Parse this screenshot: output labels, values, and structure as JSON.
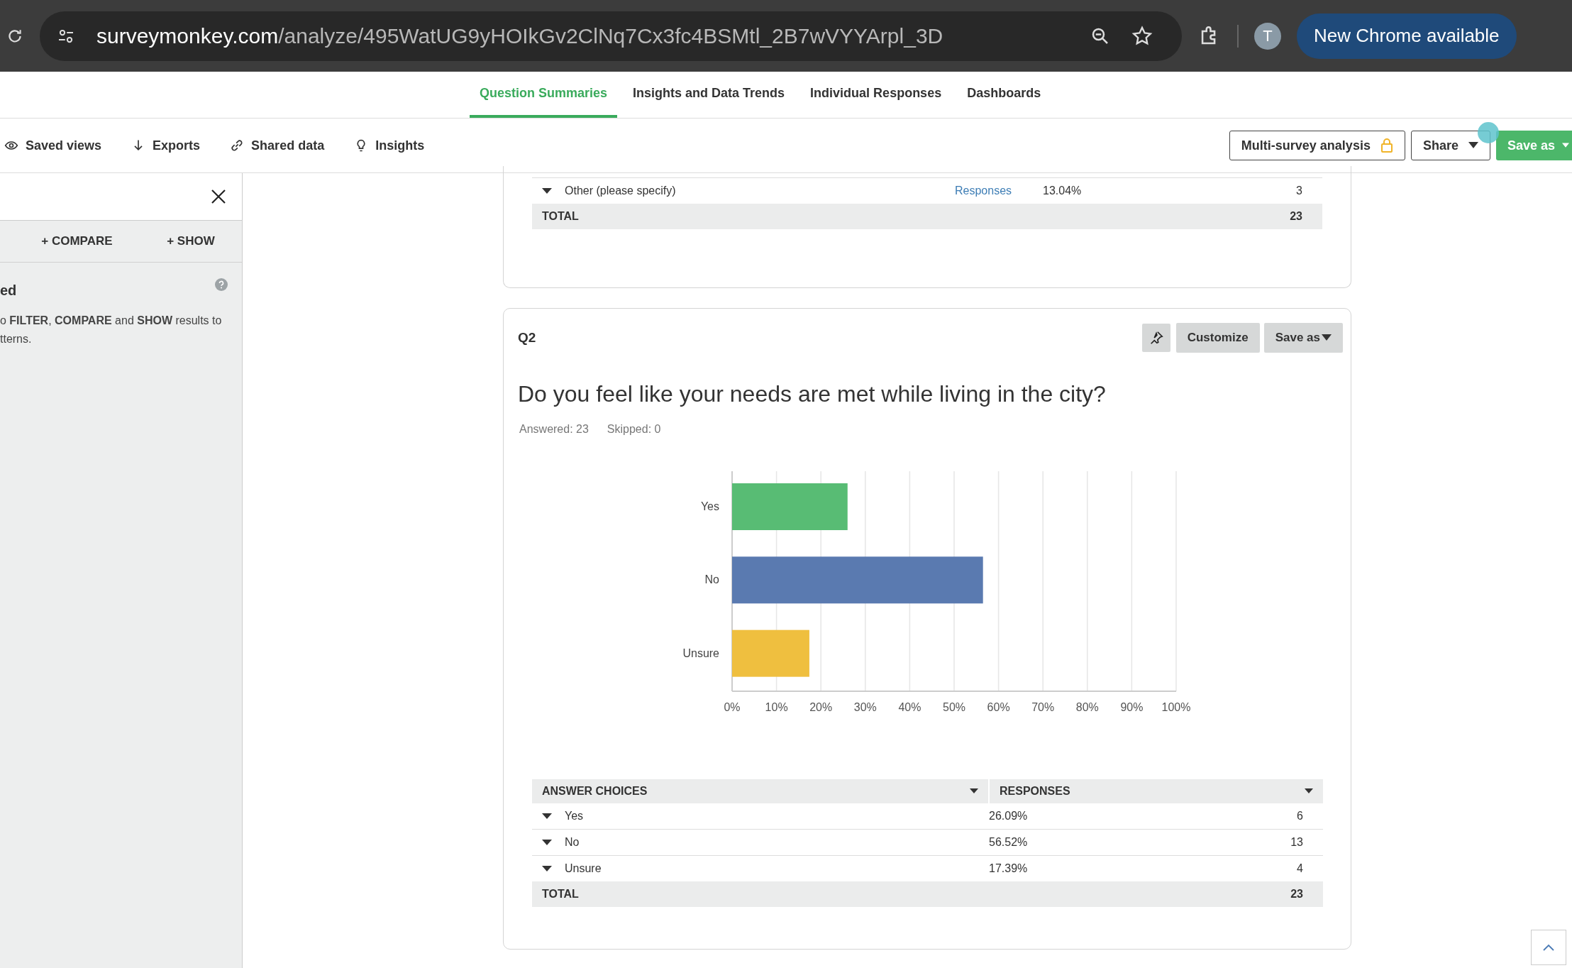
{
  "browser": {
    "url_domain": "surveymonkey.com",
    "url_path": "/analyze/495WatUG9yHOIkGv2ClNq7Cx3fc4BSMtl_2B7wVYYArpl_3D",
    "profile_initial": "T",
    "update_button": "New Chrome available"
  },
  "nav_tabs": [
    {
      "label": "Question Summaries",
      "selected": true
    },
    {
      "label": "Insights and Data Trends",
      "selected": false
    },
    {
      "label": "Individual Responses",
      "selected": false
    },
    {
      "label": "Dashboards",
      "selected": false
    }
  ],
  "toolbar": {
    "links": [
      {
        "kind": "eye",
        "label": "Saved views"
      },
      {
        "kind": "download",
        "label": "Exports"
      },
      {
        "kind": "link",
        "label": "Shared data"
      },
      {
        "kind": "bulb",
        "label": "Insights"
      }
    ],
    "multi_survey": "Multi-survey analysis",
    "share": "Share",
    "save_as": "Save as"
  },
  "sidebar": {
    "compare": "+ COMPARE",
    "show": "+ SHOW",
    "heading": "ed",
    "lines": [
      "o **FILTER**, **COMPARE** and **SHOW** results to",
      "tterns."
    ]
  },
  "previous_question": {
    "rows": [
      {
        "choice": "Other (please specify)",
        "link": "Responses",
        "percent": "13.04%",
        "count": "3"
      }
    ],
    "total_label": "TOTAL",
    "total": "23"
  },
  "question": {
    "number": "Q2",
    "customize": "Customize",
    "save_as": "Save as",
    "title": "Do you feel like your needs are met while living in the city?",
    "answered": "Answered: 23",
    "skipped": "Skipped: 0",
    "chart_data": {
      "type": "bar",
      "orientation": "horizontal",
      "grid": true,
      "categories": [
        "Yes",
        "No",
        "Unsure"
      ],
      "series": [
        {
          "values": [
            26,
            56.5,
            17.4
          ]
        }
      ],
      "colors": [
        "#58bc74",
        "#5a7ab0",
        "#efbf3f"
      ],
      "xlim": [
        0,
        100
      ],
      "xticks": [
        {
          "value": 0,
          "label": "0%"
        },
        {
          "value": 10,
          "label": "10%"
        },
        {
          "value": 20,
          "label": "20%"
        },
        {
          "value": 30,
          "label": "30%"
        },
        {
          "value": 40,
          "label": "40%"
        },
        {
          "value": 50,
          "label": "50%"
        },
        {
          "value": 60,
          "label": "60%"
        },
        {
          "value": 70,
          "label": "70%"
        },
        {
          "value": 80,
          "label": "80%"
        },
        {
          "value": 90,
          "label": "90%"
        },
        {
          "value": 100,
          "label": "100%"
        }
      ]
    },
    "table": {
      "columns": [
        "ANSWER CHOICES",
        "RESPONSES"
      ],
      "rows": [
        {
          "choice": "Yes",
          "percent": "26.09%",
          "count": "6"
        },
        {
          "choice": "No",
          "percent": "56.52%",
          "count": "13"
        },
        {
          "choice": "Unsure",
          "percent": "17.39%",
          "count": "4"
        }
      ],
      "total_label": "TOTAL",
      "total": "23"
    }
  }
}
